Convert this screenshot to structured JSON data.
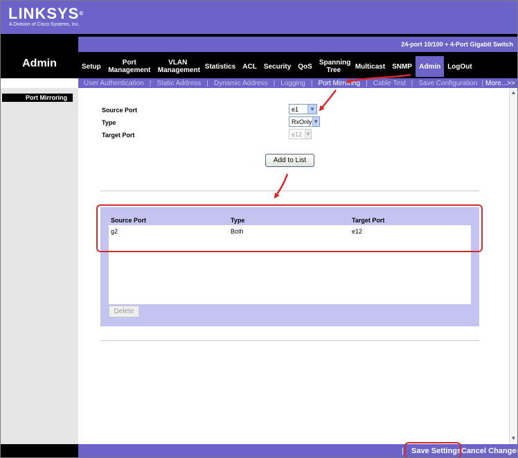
{
  "brand": {
    "logo_text": "LINKSYS",
    "logo_mark": "®",
    "tagline": "A Division of Cisco Systems, Inc."
  },
  "product_name": "24-port 10/100 + 4-Port Gigabit Switch",
  "section_title": "Admin",
  "main_nav": [
    {
      "label": "Setup"
    },
    {
      "label": "Port Management"
    },
    {
      "label": "VLAN Management"
    },
    {
      "label": "Statistics"
    },
    {
      "label": "ACL"
    },
    {
      "label": "Security"
    },
    {
      "label": "QoS"
    },
    {
      "label": "Spanning Tree"
    },
    {
      "label": "Multicast"
    },
    {
      "label": "SNMP"
    },
    {
      "label": "Admin"
    },
    {
      "label": "LogOut"
    }
  ],
  "sub_nav": [
    {
      "label": "User Authentication"
    },
    {
      "label": "Static Address"
    },
    {
      "label": "Dynamic Address"
    },
    {
      "label": "Logging"
    },
    {
      "label": "Port Mirroring"
    },
    {
      "label": "Cable Test"
    },
    {
      "label": "Save Configuration"
    },
    {
      "label": "More...>>"
    }
  ],
  "left_label": "Port Mirroring",
  "form": {
    "source_port_label": "Source Port",
    "source_port_value": "e1",
    "type_label": "Type",
    "type_value": "RxOnly",
    "target_port_label": "Target Port",
    "target_port_value": "e12",
    "add_button": "Add to List"
  },
  "table": {
    "headers": [
      "Source Port",
      "Type",
      "Target Port"
    ],
    "rows": [
      [
        "g2",
        "Both",
        "e12"
      ]
    ],
    "delete_button": "Delete"
  },
  "footer": {
    "save": "Save Settings",
    "cancel": "Cancel Changes"
  },
  "colors": {
    "accent": "#6b63c7",
    "annotation": "#d42a2a"
  }
}
